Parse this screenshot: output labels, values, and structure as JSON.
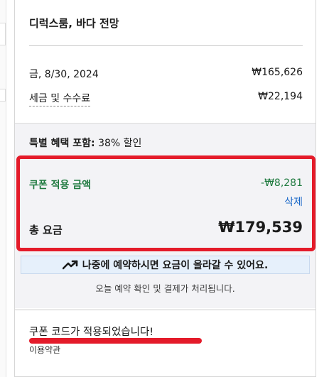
{
  "room": {
    "title": "디럭스룸, 바다 전망"
  },
  "lines": [
    {
      "label": "금, 8/30, 2024",
      "value": "₩165,626"
    },
    {
      "label": "세금 및 수수료",
      "value": "₩22,194"
    }
  ],
  "special": {
    "prefix": "특별 혜택 포함:",
    "text": "38% 할인"
  },
  "coupon": {
    "label": "쿠폰 적용 금액",
    "value": "-₩8,281",
    "remove_label": "삭제"
  },
  "total": {
    "label": "총 요금",
    "value": "₩179,539"
  },
  "banner": {
    "text": "나중에 예약하시면 요금이 올라갈 수 있어요.",
    "icon": "trending-up-icon"
  },
  "note": {
    "text": "오늘 예약 확인 및 결제가 처리됩니다."
  },
  "applied": {
    "text": "쿠폰 코드가 적용되었습니다!",
    "sub": "이용약관"
  },
  "colors": {
    "accent_red": "#e41b2a",
    "coupon_green": "#1f7a3f",
    "link_blue": "#1a68c8"
  }
}
